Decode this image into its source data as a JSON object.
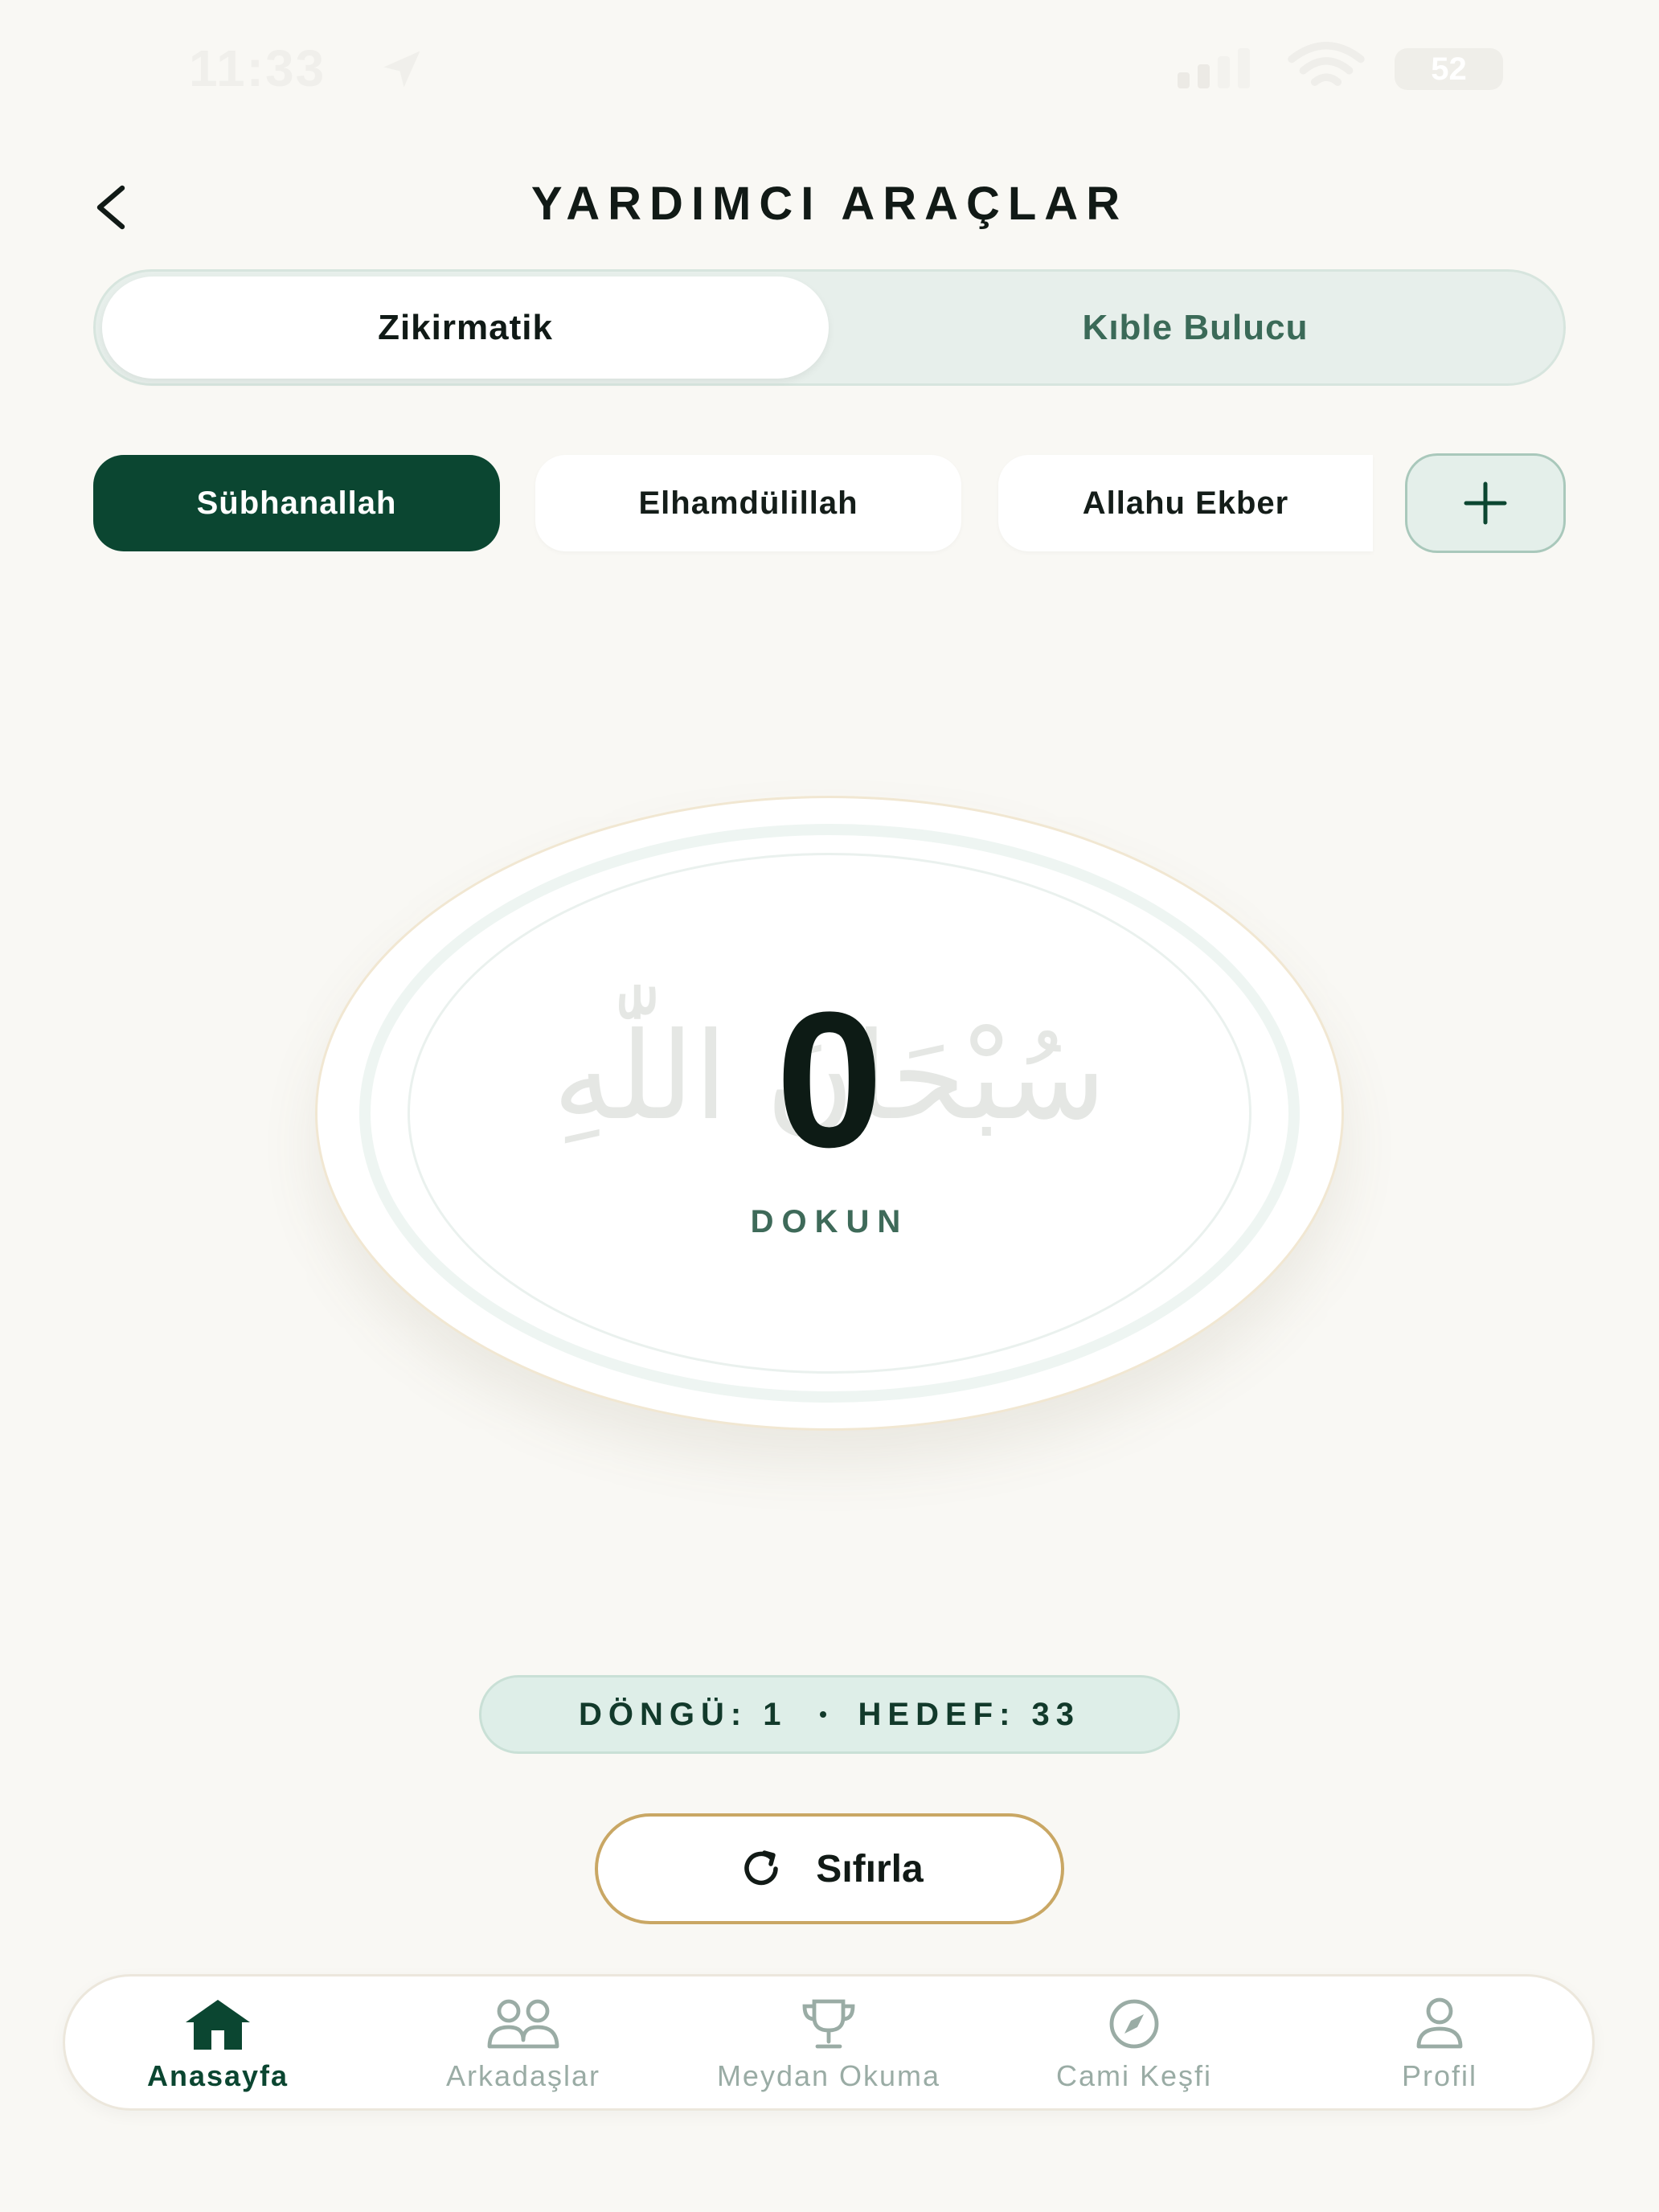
{
  "status_bar": {
    "time": "11:33",
    "battery": "52"
  },
  "header": {
    "title": "YARDIMCI ARAÇLAR"
  },
  "tabs": [
    {
      "label": "Zikirmatik",
      "active": true
    },
    {
      "label": "Kıble Bulucu",
      "active": false
    }
  ],
  "dhikr_chips": [
    {
      "label": "Sübhanallah",
      "active": true
    },
    {
      "label": "Elhamdülillah",
      "active": false
    },
    {
      "label": "Allahu Ekber",
      "active": false
    }
  ],
  "counter": {
    "value": "0",
    "arabic": "سُبْحَانَ اللّٰهِ",
    "hint": "DOKUN"
  },
  "cycle": {
    "cycle_text": "DÖNGÜ: 1",
    "target_text": "HEDEF: 33"
  },
  "reset": {
    "label": "Sıfırla"
  },
  "bottom_nav": [
    {
      "label": "Anasayfa",
      "icon": "home-icon",
      "active": true
    },
    {
      "label": "Arkadaşlar",
      "icon": "friends-icon",
      "active": false
    },
    {
      "label": "Meydan Okuma",
      "icon": "trophy-icon",
      "active": false
    },
    {
      "label": "Cami Keşfi",
      "icon": "compass-icon",
      "active": false
    },
    {
      "label": "Profil",
      "icon": "profile-icon",
      "active": false
    }
  ],
  "colors": {
    "primary": "#0b4631",
    "background": "#f9f8f4",
    "accent_gold": "#c9a764",
    "pill_bg": "#deeee8"
  }
}
